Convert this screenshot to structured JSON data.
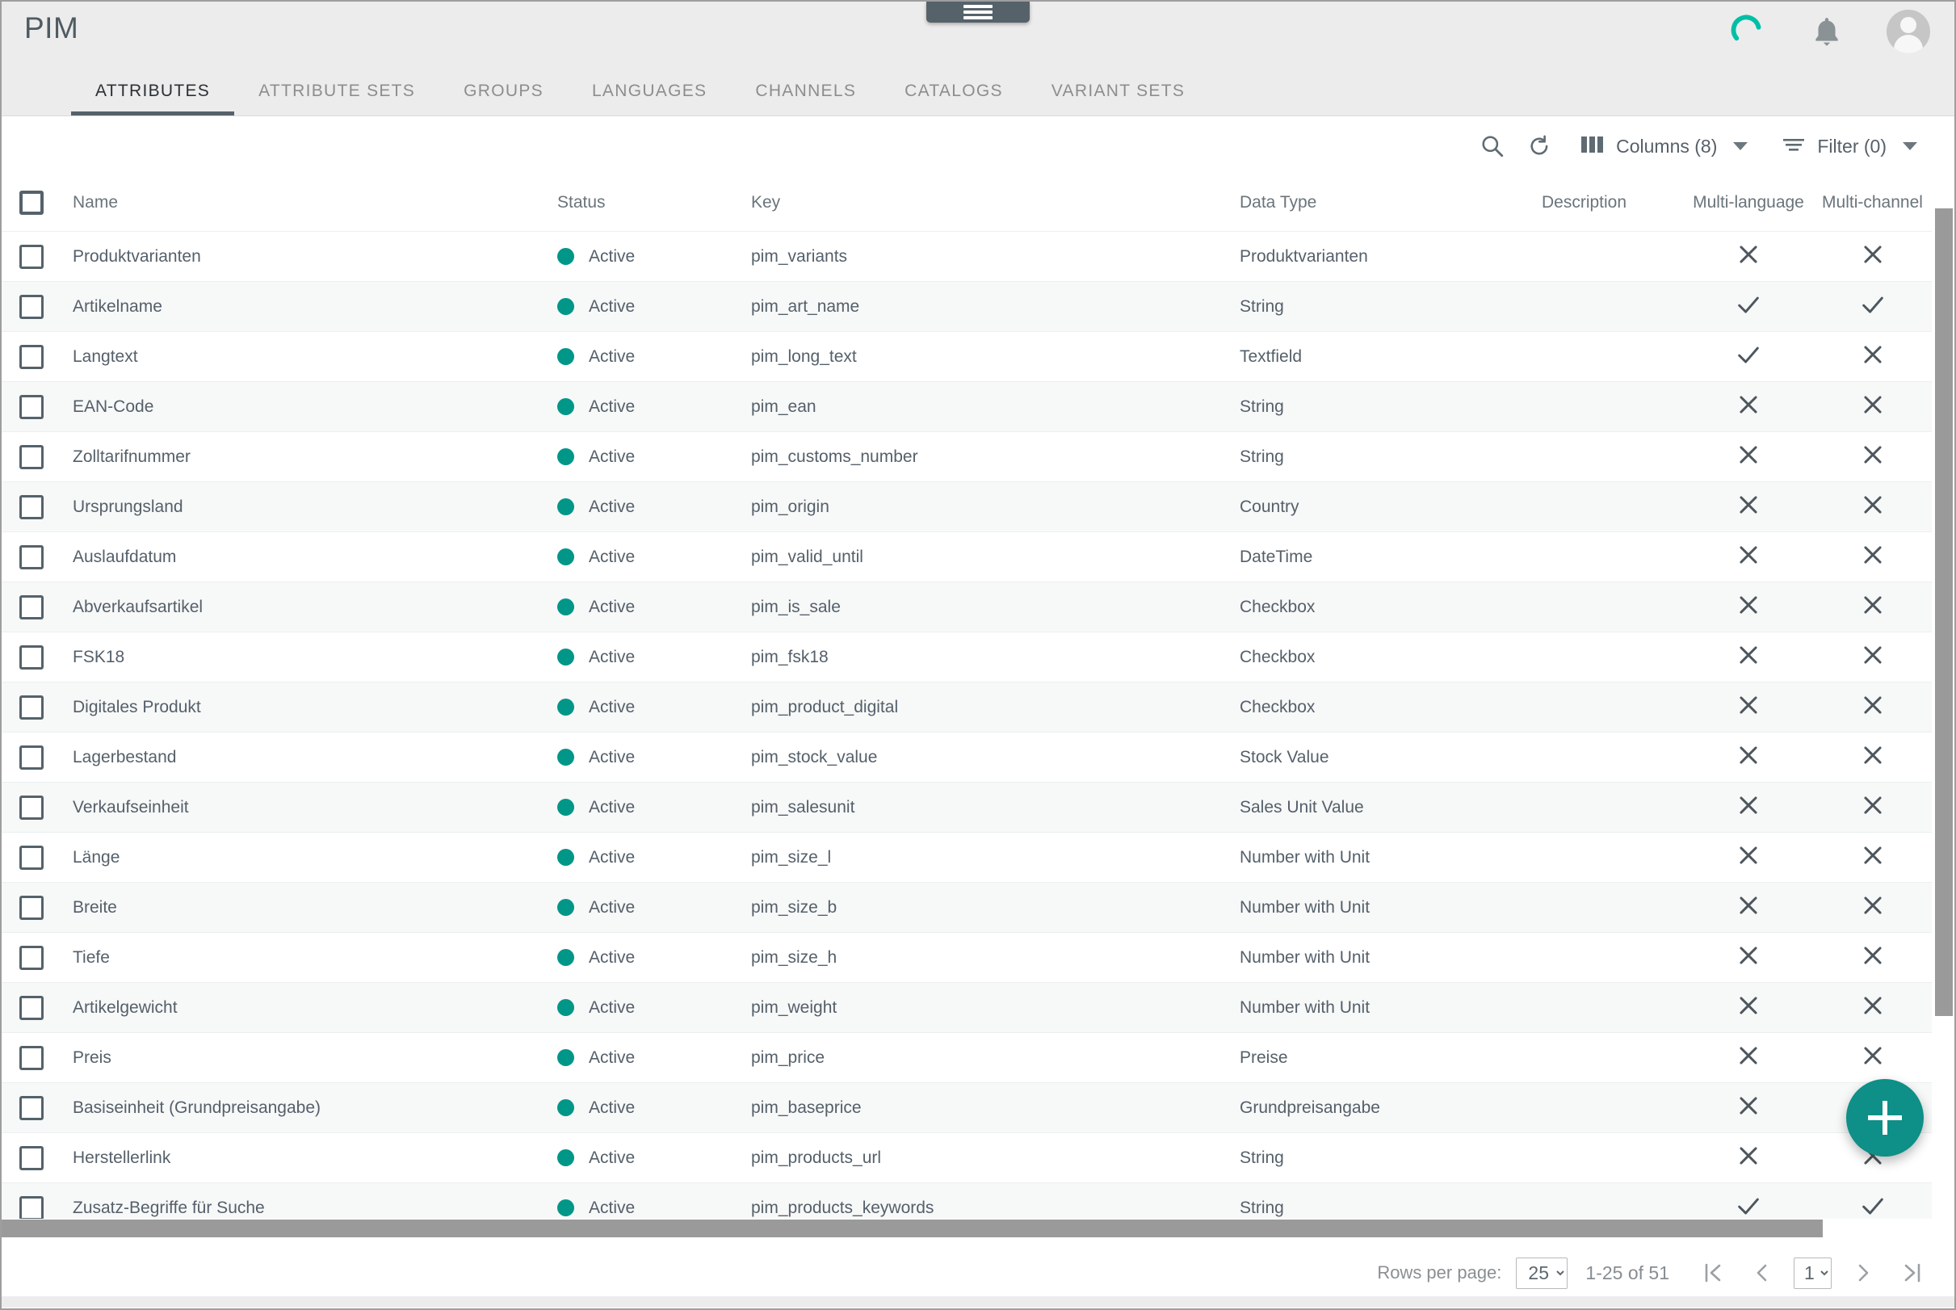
{
  "window": {
    "drag_handle": "drag-handle"
  },
  "header": {
    "title": "PIM",
    "icons": [
      {
        "name": "sync-spinner-icon",
        "color": "#00bfa5"
      },
      {
        "name": "notifications-bell-icon",
        "color": "#8a9296"
      },
      {
        "name": "user-avatar",
        "color": "#c6c6c6"
      }
    ]
  },
  "tabs": [
    {
      "label": "ATTRIBUTES",
      "active": true
    },
    {
      "label": "ATTRIBUTE SETS",
      "active": false
    },
    {
      "label": "GROUPS",
      "active": false
    },
    {
      "label": "LANGUAGES",
      "active": false
    },
    {
      "label": "CHANNELS",
      "active": false
    },
    {
      "label": "CATALOGS",
      "active": false
    },
    {
      "label": "VARIANT SETS",
      "active": false
    }
  ],
  "toolbar": {
    "search_icon": "search-icon",
    "refresh_icon": "refresh-icon",
    "columns_label": "Columns (8)",
    "filter_label": "Filter (0)"
  },
  "table": {
    "columns": [
      "Name",
      "Status",
      "Key",
      "Data Type",
      "Description",
      "Multi-language",
      "Multi-channel"
    ],
    "rows": [
      {
        "name": "Produktvarianten",
        "status": "Active",
        "key": "pim_variants",
        "type": "Produktvarianten",
        "description": "",
        "multi_language": "x",
        "multi_channel": "x"
      },
      {
        "name": "Artikelname",
        "status": "Active",
        "key": "pim_art_name",
        "type": "String",
        "description": "",
        "multi_language": "check",
        "multi_channel": "check"
      },
      {
        "name": "Langtext",
        "status": "Active",
        "key": "pim_long_text",
        "type": "Textfield",
        "description": "",
        "multi_language": "check",
        "multi_channel": "x"
      },
      {
        "name": "EAN-Code",
        "status": "Active",
        "key": "pim_ean",
        "type": "String",
        "description": "",
        "multi_language": "x",
        "multi_channel": "x"
      },
      {
        "name": "Zolltarifnummer",
        "status": "Active",
        "key": "pim_customs_number",
        "type": "String",
        "description": "",
        "multi_language": "x",
        "multi_channel": "x"
      },
      {
        "name": "Ursprungsland",
        "status": "Active",
        "key": "pim_origin",
        "type": "Country",
        "description": "",
        "multi_language": "x",
        "multi_channel": "x"
      },
      {
        "name": "Auslaufdatum",
        "status": "Active",
        "key": "pim_valid_until",
        "type": "DateTime",
        "description": "",
        "multi_language": "x",
        "multi_channel": "x"
      },
      {
        "name": "Abverkaufsartikel",
        "status": "Active",
        "key": "pim_is_sale",
        "type": "Checkbox",
        "description": "",
        "multi_language": "x",
        "multi_channel": "x"
      },
      {
        "name": "FSK18",
        "status": "Active",
        "key": "pim_fsk18",
        "type": "Checkbox",
        "description": "",
        "multi_language": "x",
        "multi_channel": "x"
      },
      {
        "name": "Digitales Produkt",
        "status": "Active",
        "key": "pim_product_digital",
        "type": "Checkbox",
        "description": "",
        "multi_language": "x",
        "multi_channel": "x"
      },
      {
        "name": "Lagerbestand",
        "status": "Active",
        "key": "pim_stock_value",
        "type": "Stock Value",
        "description": "",
        "multi_language": "x",
        "multi_channel": "x"
      },
      {
        "name": "Verkaufseinheit",
        "status": "Active",
        "key": "pim_salesunit",
        "type": "Sales Unit Value",
        "description": "",
        "multi_language": "x",
        "multi_channel": "x"
      },
      {
        "name": "Länge",
        "status": "Active",
        "key": "pim_size_l",
        "type": "Number with Unit",
        "description": "",
        "multi_language": "x",
        "multi_channel": "x"
      },
      {
        "name": "Breite",
        "status": "Active",
        "key": "pim_size_b",
        "type": "Number with Unit",
        "description": "",
        "multi_language": "x",
        "multi_channel": "x"
      },
      {
        "name": "Tiefe",
        "status": "Active",
        "key": "pim_size_h",
        "type": "Number with Unit",
        "description": "",
        "multi_language": "x",
        "multi_channel": "x"
      },
      {
        "name": "Artikelgewicht",
        "status": "Active",
        "key": "pim_weight",
        "type": "Number with Unit",
        "description": "",
        "multi_language": "x",
        "multi_channel": "x"
      },
      {
        "name": "Preis",
        "status": "Active",
        "key": "pim_price",
        "type": "Preise",
        "description": "",
        "multi_language": "x",
        "multi_channel": "x"
      },
      {
        "name": "Basiseinheit (Grundpreisangabe)",
        "status": "Active",
        "key": "pim_baseprice",
        "type": "Grundpreisangabe",
        "description": "",
        "multi_language": "x",
        "multi_channel": "x"
      },
      {
        "name": "Herstellerlink",
        "status": "Active",
        "key": "pim_products_url",
        "type": "String",
        "description": "",
        "multi_language": "x",
        "multi_channel": "x"
      },
      {
        "name": "Zusatz-Begriffe für Suche",
        "status": "Active",
        "key": "pim_products_keywords",
        "type": "String",
        "description": "",
        "multi_language": "check",
        "multi_channel": "check"
      }
    ]
  },
  "fab": {
    "name": "add-attribute-button",
    "icon": "plus-icon",
    "color": "#0e8f88"
  },
  "footer": {
    "rows_per_page_label": "Rows per page:",
    "rows_per_page_value": "25",
    "rows_per_page_options": [
      "25"
    ],
    "range_label": "1-25 of 51",
    "first_page_icon": "first-page-icon",
    "prev_page_icon": "previous-page-icon",
    "page_value": "1",
    "page_options": [
      "1"
    ],
    "next_page_icon": "next-page-icon",
    "last_page_icon": "last-page-icon"
  },
  "colors": {
    "accent": "#009688",
    "status_active": "#009688",
    "tab_underline": "#56626a"
  }
}
